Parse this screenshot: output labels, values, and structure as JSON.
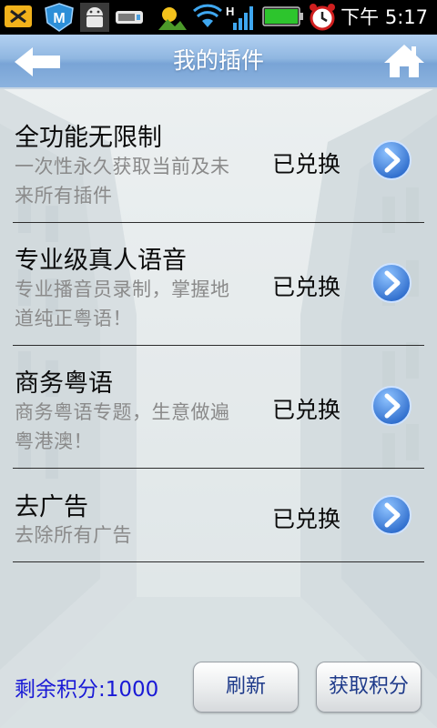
{
  "status_bar": {
    "icons": [
      "close-box-icon",
      "shield-m-icon",
      "android-icon",
      "usb-icon",
      "weather-icon",
      "wifi-icon",
      "signal-h-icon",
      "battery-icon",
      "alarm-icon"
    ],
    "time": "下午 5:17"
  },
  "header": {
    "title": "我的插件",
    "back_icon": "back-arrow-icon",
    "home_icon": "home-icon"
  },
  "plugins": [
    {
      "name": "全功能无限制",
      "desc": "一次性永久获取当前及未来所有插件",
      "status": "已兑换"
    },
    {
      "name": "专业级真人语音",
      "desc": "专业播音员录制，掌握地道纯正粤语！",
      "status": "已兑换"
    },
    {
      "name": "商务粤语",
      "desc": "商务粤语专题，生意做遍粤港澳！",
      "status": "已兑换"
    },
    {
      "name": "去广告",
      "desc": "去除所有广告",
      "status": "已兑换"
    }
  ],
  "footer": {
    "points_label": "剩余积分:1000",
    "refresh_label": "刷新",
    "get_points_label": "获取积分"
  },
  "colors": {
    "title_bar": "#8cb3df",
    "points_text": "#1a1ad6",
    "chevron": "#2c6fd0"
  }
}
